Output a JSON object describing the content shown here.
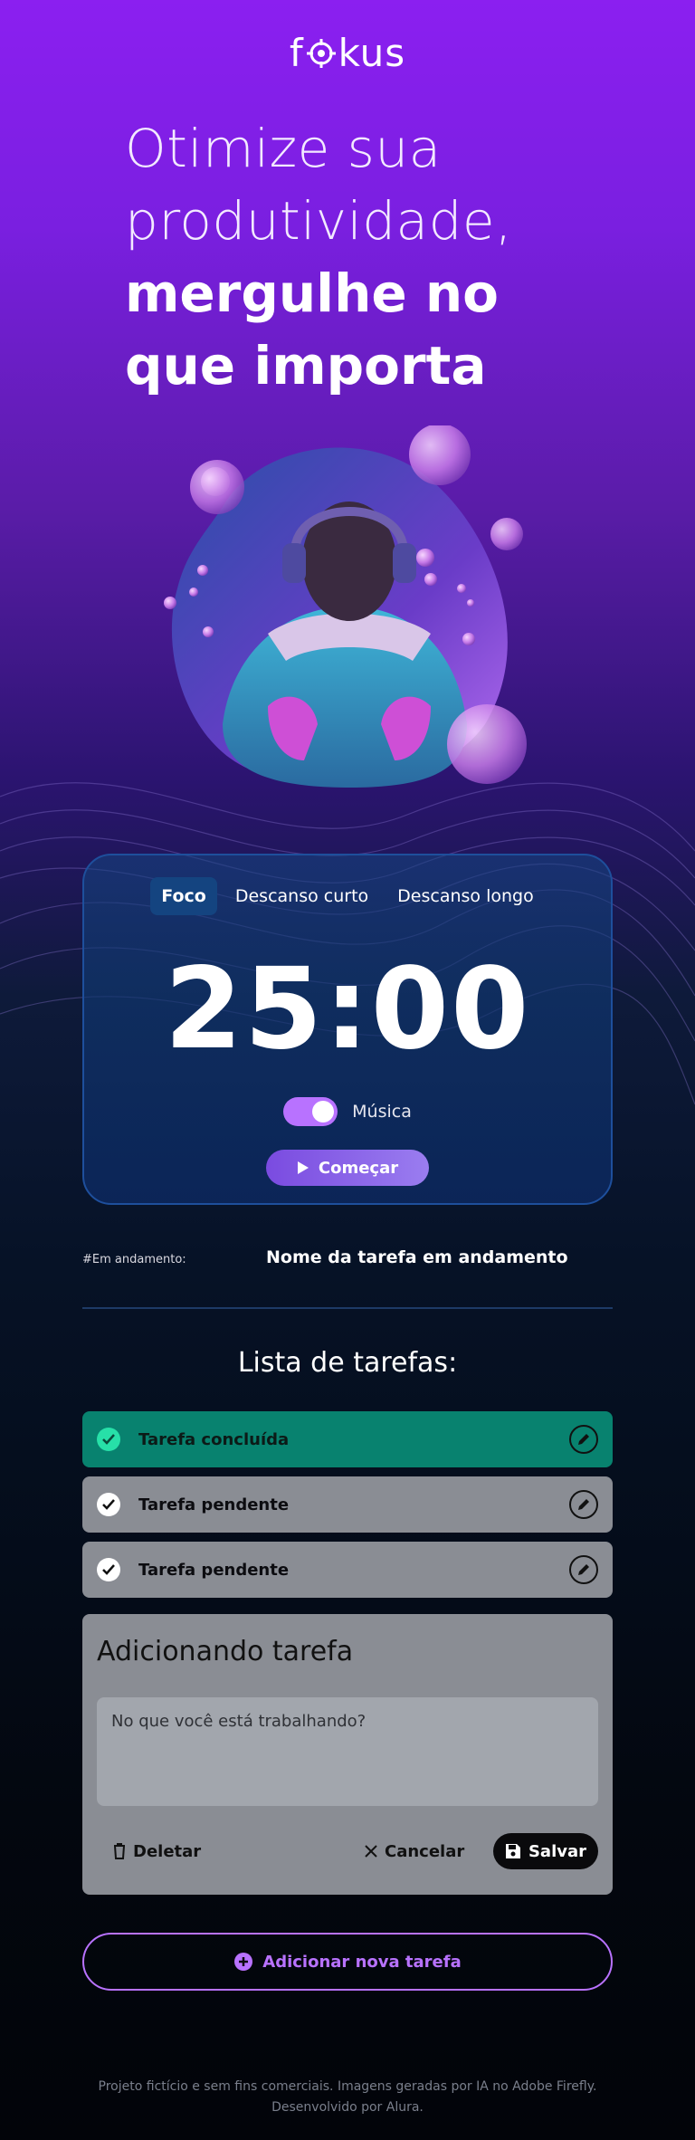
{
  "header": {
    "logo_prefix": "f",
    "logo_suffix": "kus"
  },
  "hero": {
    "line1": "Otimize sua",
    "line2": "produtividade,",
    "line3": "mergulhe no",
    "line4": "que importa"
  },
  "timer_card": {
    "tabs": [
      {
        "label": "Foco",
        "active": true
      },
      {
        "label": "Descanso curto",
        "active": false
      },
      {
        "label": "Descanso longo",
        "active": false
      }
    ],
    "time": "25:00",
    "music_label": "Música",
    "music_on": true,
    "start_label": "Começar"
  },
  "in_progress": {
    "label": "#Em andamento:",
    "task": "Nome da tarefa em andamento"
  },
  "task_list": {
    "title": "Lista de tarefas:",
    "items": [
      {
        "label": "Tarefa concluída",
        "status": "done"
      },
      {
        "label": "Tarefa pendente",
        "status": "pending"
      },
      {
        "label": "Tarefa pendente",
        "status": "pending"
      }
    ]
  },
  "form": {
    "title": "Adicionando tarefa",
    "placeholder": "No que você está trabalhando?",
    "delete_label": "Deletar",
    "cancel_label": "Cancelar",
    "save_label": "Salvar"
  },
  "add_button_label": "Adicionar nova tarefa",
  "footer": {
    "line1": "Projeto fictício e sem fins comerciais. Imagens geradas por IA no Adobe Firefly.",
    "line2": "Desenvolvido por Alura."
  },
  "colors": {
    "accent": "#b872ff",
    "done_task": "#08826f",
    "pending_task": "#8a8d94",
    "check_done": "#27e0a8",
    "card_border": "#1e4f9c"
  }
}
